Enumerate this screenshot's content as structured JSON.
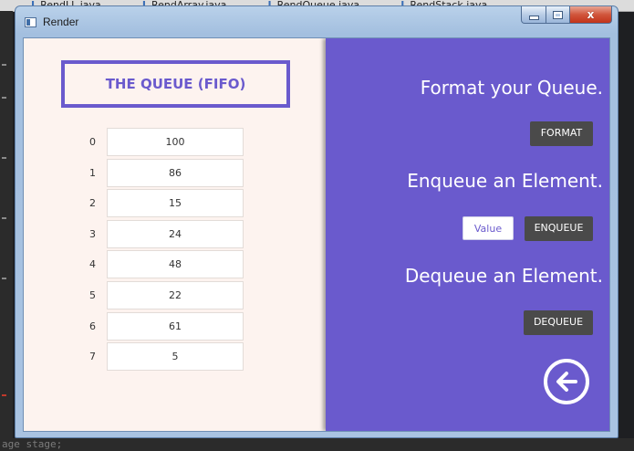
{
  "ide": {
    "tabs": [
      "RendLL.java",
      "RendArray.java",
      "RendQueue.java",
      "RendStack.java"
    ],
    "bottom_code": "age stage;"
  },
  "window": {
    "title": "Render",
    "icon": "app-window-icon",
    "controls": {
      "minimize_icon": "minimize-icon",
      "maximize_icon": "maximize-icon",
      "close_icon": "close-icon",
      "close_glyph": "x"
    }
  },
  "queue": {
    "title": "THE QUEUE (FIFO)",
    "rows": [
      {
        "index": "0",
        "value": "100"
      },
      {
        "index": "1",
        "value": "86"
      },
      {
        "index": "2",
        "value": "15"
      },
      {
        "index": "3",
        "value": "24"
      },
      {
        "index": "4",
        "value": "48"
      },
      {
        "index": "5",
        "value": "22"
      },
      {
        "index": "6",
        "value": "61"
      },
      {
        "index": "7",
        "value": "5"
      }
    ]
  },
  "controls": {
    "format_heading": "Format your Queue.",
    "format_button": "FORMAT",
    "enqueue_heading": "Enqueue an Element.",
    "value_placeholder": "Value",
    "enqueue_button": "ENQUEUE",
    "dequeue_heading": "Dequeue an Element.",
    "dequeue_button": "DEQUEUE",
    "back_icon": "back-arrow-icon"
  },
  "colors": {
    "accent": "#6a5acd",
    "panel_left": "#fdf3ef",
    "button_dark": "#4a4a4a"
  }
}
